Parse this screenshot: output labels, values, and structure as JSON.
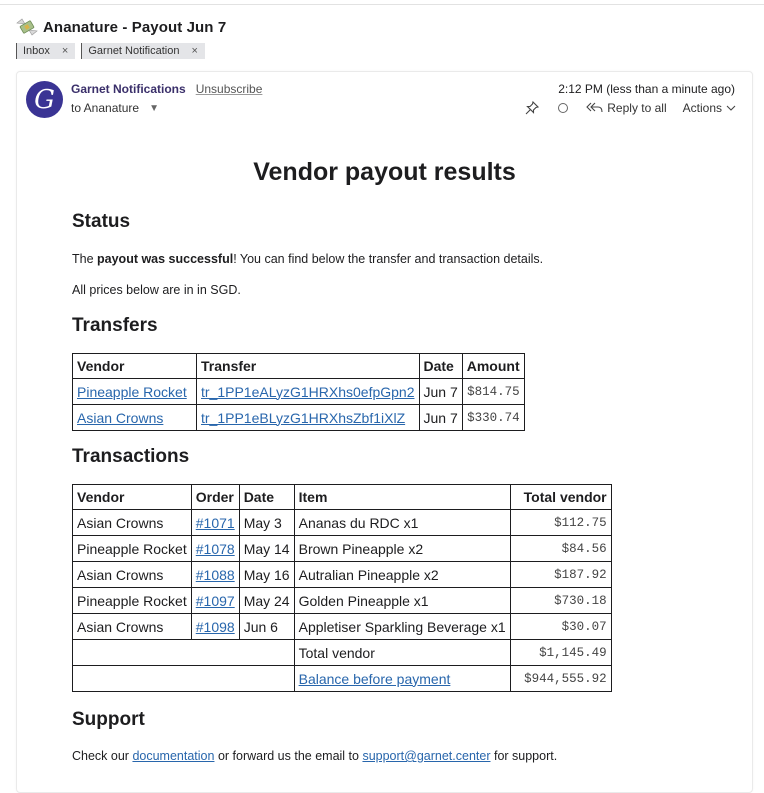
{
  "subject": {
    "icon": "money-with-wings-icon",
    "title": "Ananature - Payout Jun 7"
  },
  "labels": [
    {
      "name": "Inbox",
      "remove": "×"
    },
    {
      "name": "Garnet Notification",
      "remove": "×"
    }
  ],
  "header": {
    "avatar_letter": "G",
    "sender": "Garnet Notifications",
    "unsubscribe": "Unsubscribe",
    "recipient": "to Ananature",
    "recipient_caret": "▼",
    "timestamp": "2:12 PM (less than a minute ago)",
    "reply_all": "Reply to all",
    "actions": "Actions"
  },
  "body": {
    "title": "Vendor payout results",
    "status_heading": "Status",
    "status_prefix": "The ",
    "status_bold": "payout was successful",
    "status_suffix": "! You can find below the transfer and transaction details.",
    "currency_note": "All prices below are in in SGD.",
    "transfers_heading": "Transfers",
    "transfers": {
      "columns": [
        "Vendor",
        "Transfer",
        "Date",
        "Amount"
      ],
      "rows": [
        {
          "vendor": "Pineapple Rocket",
          "transfer": "tr_1PP1eALyzG1HRXhs0efpGpn2",
          "date": "Jun 7",
          "amount": "$814.75"
        },
        {
          "vendor": "Asian Crowns",
          "transfer": "tr_1PP1eBLyzG1HRXhsZbf1iXlZ",
          "date": "Jun 7",
          "amount": "$330.74"
        }
      ]
    },
    "transactions_heading": "Transactions",
    "transactions": {
      "columns": [
        "Vendor",
        "Order",
        "Date",
        "Item",
        "Total vendor"
      ],
      "rows": [
        {
          "vendor": "Asian Crowns",
          "order": "#1071",
          "date": "May 3",
          "item": "Ananas du RDC x1",
          "total": "$112.75"
        },
        {
          "vendor": "Pineapple Rocket",
          "order": "#1078",
          "date": "May 14",
          "item": "Brown Pineapple x2",
          "total": "$84.56"
        },
        {
          "vendor": "Asian Crowns",
          "order": "#1088",
          "date": "May 16",
          "item": "Autralian Pineapple x2",
          "total": "$187.92"
        },
        {
          "vendor": "Pineapple Rocket",
          "order": "#1097",
          "date": "May 24",
          "item": "Golden Pineapple x1",
          "total": "$730.18"
        },
        {
          "vendor": "Asian Crowns",
          "order": "#1098",
          "date": "Jun 6",
          "item": "Appletiser Sparkling Beverage x1",
          "total": "$30.07"
        }
      ],
      "total_label": "Total vendor",
      "total_value": "$1,145.49",
      "balance_label": "Balance before payment",
      "balance_value": "$944,555.92"
    },
    "support_heading": "Support",
    "support_prefix": "Check our ",
    "support_doc_link": "documentation",
    "support_middle": " or forward us the email to ",
    "support_email": "support@garnet.center",
    "support_suffix": " for support."
  },
  "colors": {
    "link": "#2866ac",
    "avatar_bg": "#3a3494",
    "sender": "#3a2f6a"
  }
}
